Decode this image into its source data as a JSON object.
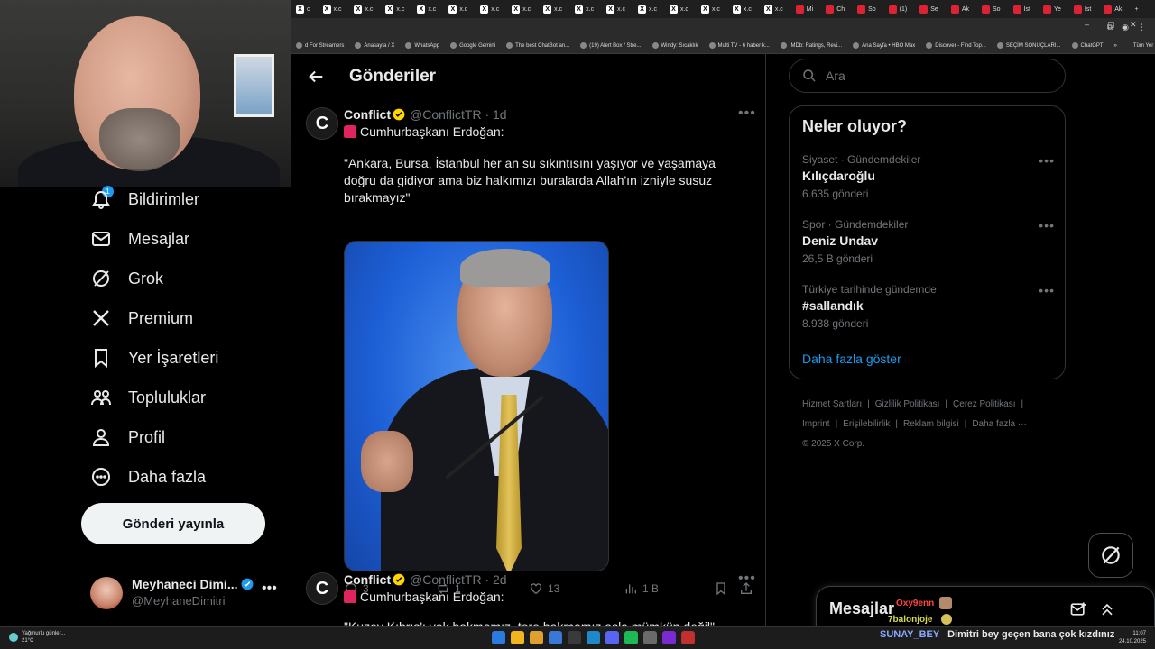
{
  "browser": {
    "tabs": [
      {
        "label": "c",
        "icon": "x-logo-icon"
      },
      {
        "label": "x.c",
        "icon": "x-logo-icon"
      },
      {
        "label": "x.c",
        "icon": "x-logo-icon"
      },
      {
        "label": "x.c",
        "icon": "x-logo-icon"
      },
      {
        "label": "x.c",
        "icon": "x-logo-icon"
      },
      {
        "label": "x.c",
        "icon": "x-logo-icon"
      },
      {
        "label": "x.c",
        "icon": "x-logo-icon"
      },
      {
        "label": "x.c",
        "icon": "x-logo-icon"
      },
      {
        "label": "x.c",
        "icon": "x-logo-icon"
      },
      {
        "label": "x.c",
        "icon": "x-logo-icon"
      },
      {
        "label": "x.c",
        "icon": "x-logo-icon"
      },
      {
        "label": "x.c",
        "icon": "x-logo-icon"
      },
      {
        "label": "x.c",
        "icon": "x-logo-icon"
      },
      {
        "label": "x.c",
        "icon": "x-logo-icon"
      },
      {
        "label": "x.c",
        "icon": "x-logo-icon"
      },
      {
        "label": "x.c",
        "icon": "x-logo-icon"
      },
      {
        "label": "Mi",
        "icon": "news-icon"
      },
      {
        "label": "Ch",
        "icon": "chat-icon"
      },
      {
        "label": "So",
        "icon": "news-icon"
      },
      {
        "label": "(1)",
        "icon": "youtube-icon"
      },
      {
        "label": "Se",
        "icon": "doc-icon"
      },
      {
        "label": "Ak",
        "icon": "news-icon"
      },
      {
        "label": "So",
        "icon": "news-icon"
      },
      {
        "label": "İst",
        "icon": "doc-icon"
      },
      {
        "label": "Ye",
        "icon": "news-icon"
      },
      {
        "label": "İst",
        "icon": "news-icon"
      },
      {
        "label": "Ak",
        "icon": "doc-icon"
      }
    ],
    "new_tab": "+",
    "bookmarks": [
      "d For Streamers",
      "Anasayfa / X",
      "WhatsApp",
      "Google Gemini",
      "The best ChatBot an...",
      "(19) Alert Box / Stre...",
      "Windy: Sıcaklık",
      "Multi TV - 6 haber k...",
      "IMDb: Ratings, Revi...",
      "Ana Sayfa • HBO Max",
      "Discover - Find Top...",
      "SEÇİM SONUÇLARI...",
      "ChatGPT"
    ],
    "all_bookmarks": "Tüm Yer İşaretleri",
    "more_bookmarks": "»"
  },
  "sidebar": {
    "items": [
      {
        "label": "Bildirimler",
        "icon": "bell-icon",
        "badge": "1"
      },
      {
        "label": "Mesajlar",
        "icon": "mail-icon"
      },
      {
        "label": "Grok",
        "icon": "grok-icon"
      },
      {
        "label": "Premium",
        "icon": "x-logo-icon"
      },
      {
        "label": "Yer İşaretleri",
        "icon": "bookmark-icon"
      },
      {
        "label": "Topluluklar",
        "icon": "people-icon"
      },
      {
        "label": "Profil",
        "icon": "person-icon"
      },
      {
        "label": "Daha fazla",
        "icon": "more-circle-icon"
      }
    ],
    "post_button": "Gönderi yayınla",
    "profile": {
      "name": "Meyhaneci Dimi...",
      "handle": "@MeyhaneDimitri",
      "more": "•••"
    }
  },
  "main": {
    "title": "Gönderiler",
    "tweets": [
      {
        "avatar_letter": "C",
        "name": "Conflict",
        "handle": "@ConflictTR",
        "time": "· 1d",
        "more": "•••",
        "line1": "Cumhurbaşkanı Erdoğan:",
        "text": "\"Ankara, Bursa, İstanbul her an su sıkıntısını yaşıyor ve yaşamaya doğru da gidiyor ama biz halkımızı buralarda Allah'ın izniyle susuz bırakmayız\"",
        "replies": "3",
        "reposts": "1",
        "likes": "13",
        "views": "1 B"
      },
      {
        "avatar_letter": "C",
        "name": "Conflict",
        "handle": "@ConflictTR",
        "time": "· 2d",
        "more": "•••",
        "line1": "Cumhurbaşkanı Erdoğan:",
        "text": "\"Kuzey Kıbrıs'ı yok bakmamız, tore bakmamız asla mümkün değil\""
      }
    ]
  },
  "right": {
    "search_placeholder": "Ara",
    "trends_title": "Neler oluyor?",
    "trends": [
      {
        "context": "Siyaset · Gündemdekiler",
        "title": "Kılıçdaroğlu",
        "count": "6.635 gönderi"
      },
      {
        "context": "Spor · Gündemdekiler",
        "title": "Deniz Undav",
        "count": "26,5 B gönderi"
      },
      {
        "context": "Türkiye tarihinde gündemde",
        "title": "#sallandık",
        "count": "8.938 gönderi"
      }
    ],
    "trend_more": "•••",
    "show_more": "Daha fazla göster",
    "footer": [
      "Hizmet Şartları",
      "|",
      "Gizlilik Politikası",
      "|",
      "Çerez Politikası",
      "|",
      "Imprint",
      "|",
      "Erişilebilirlik",
      "|",
      "Reklam bilgisi",
      "|",
      "Daha fazla ···",
      "© 2025 X Corp."
    ],
    "messages_title": "Mesajlar"
  },
  "chat": {
    "user1": "Oxy9enn",
    "user2": "7balonjoje",
    "bottom_user": "SUNAY_BEY",
    "bottom_msg": "Dimitri bey geçen bana çok kızdınız",
    "colors": {
      "user1": "#ff4444",
      "user2": "#d6d94a",
      "bottom_user": "#8aa8ff"
    }
  },
  "taskbar": {
    "weather_line1": "Yağmurlu günler...",
    "weather_line2": "21°C",
    "time": "11:07",
    "date": "24.10.2025"
  },
  "colors": {
    "accent": "#1d9bf0",
    "text": "#e7e9ea",
    "muted": "#71767b",
    "border": "#2f3336",
    "verified": "#ffd400"
  }
}
